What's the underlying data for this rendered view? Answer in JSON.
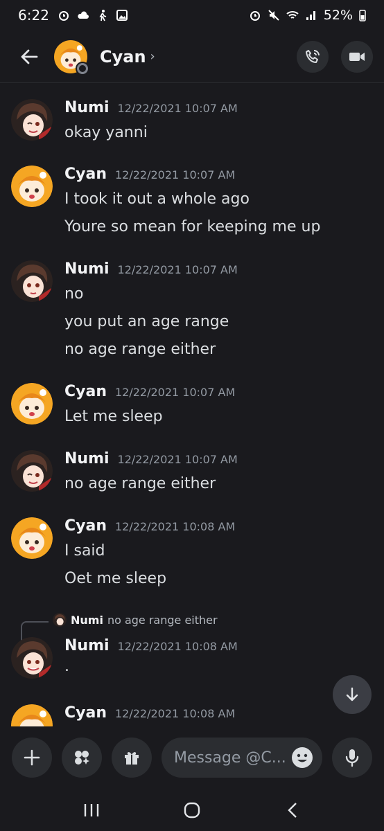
{
  "status_bar": {
    "time": "6:22",
    "battery": "52%"
  },
  "header": {
    "name": "Cyan",
    "chevron": "›",
    "back_icon": "arrow-left-icon",
    "call_icon": "phone-icon",
    "video_icon": "video-camera-icon"
  },
  "messages": [
    {
      "author": "Numi",
      "timestamp": "12/22/2021 10:07 AM",
      "lines": [
        "okay yanni"
      ]
    },
    {
      "author": "Cyan",
      "timestamp": "12/22/2021 10:07 AM",
      "lines": [
        "I took it out a whole ago",
        "Youre so mean for keeping me up"
      ]
    },
    {
      "author": "Numi",
      "timestamp": "12/22/2021 10:07 AM",
      "lines": [
        "no",
        "you put an age range",
        "no age range either"
      ]
    },
    {
      "author": "Cyan",
      "timestamp": "12/22/2021 10:07 AM",
      "lines": [
        "Let me sleep"
      ]
    },
    {
      "author": "Numi",
      "timestamp": "12/22/2021 10:07 AM",
      "lines": [
        "no age range either"
      ]
    },
    {
      "author": "Cyan",
      "timestamp": "12/22/2021 10:08 AM",
      "lines": [
        "I said",
        "Oet me sleep"
      ]
    },
    {
      "author": "Numi",
      "timestamp": "12/22/2021 10:08 AM",
      "lines": [
        "."
      ]
    },
    {
      "author": "Cyan",
      "timestamp": "12/22/2021 10:08 AM",
      "lines": []
    }
  ],
  "reply": {
    "author": "Numi",
    "text": "no age range either"
  },
  "composer": {
    "placeholder": "Message @C..."
  },
  "colors": {
    "background": "#1a1a1e",
    "surface": "#2b2d31",
    "muted_text": "#949ba4",
    "cyan_avatar": "#f5a623",
    "numi_avatar": "#5a3a2e"
  }
}
